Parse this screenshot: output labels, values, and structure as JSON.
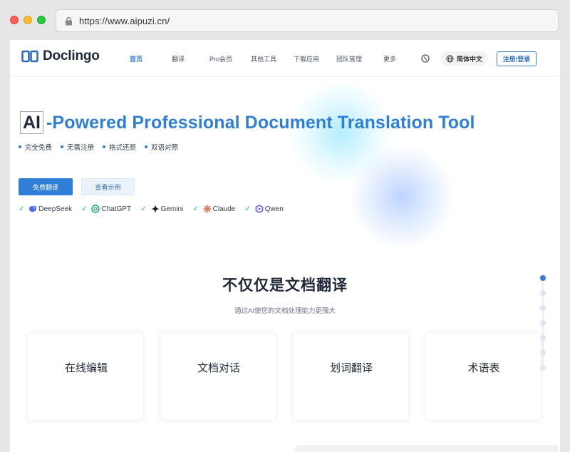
{
  "browser": {
    "url": "https://www.aipuzi.cn/"
  },
  "nav": {
    "logo_text": "Doclingo",
    "items": [
      {
        "label": "首页",
        "active": true
      },
      {
        "label": "翻译"
      },
      {
        "label": "Pro会员"
      },
      {
        "label": "其他工具"
      },
      {
        "label": "下载应用"
      },
      {
        "label": "团队管理"
      },
      {
        "label": "更多"
      }
    ],
    "language": "简体中文",
    "login_label": "注册/登录"
  },
  "hero": {
    "ai_badge": "AI",
    "title_rest": "-Powered Professional Document Translation Tool",
    "features": [
      "完全免费",
      "无需注册",
      "格式还原",
      "双语对照"
    ],
    "primary_button": "免费翻译",
    "secondary_button": "查看示例",
    "models": [
      {
        "name": "DeepSeek",
        "icon": "deepseek-icon"
      },
      {
        "name": "ChatGPT",
        "icon": "chatgpt-icon"
      },
      {
        "name": "Gemini",
        "icon": "gemini-icon"
      },
      {
        "name": "Claude",
        "icon": "claude-icon"
      },
      {
        "name": "Qwen",
        "icon": "qwen-icon"
      }
    ]
  },
  "section": {
    "title": "不仅仅是文档翻译",
    "subtitle": "通过AI使您的文档处理能力更强大",
    "cards": [
      {
        "label": "在线编辑"
      },
      {
        "label": "文档对话"
      },
      {
        "label": "划词翻译"
      },
      {
        "label": "术语表"
      }
    ]
  },
  "colors": {
    "accent": "#2f7fd8",
    "text": "#1f2937",
    "check": "#10b981"
  }
}
